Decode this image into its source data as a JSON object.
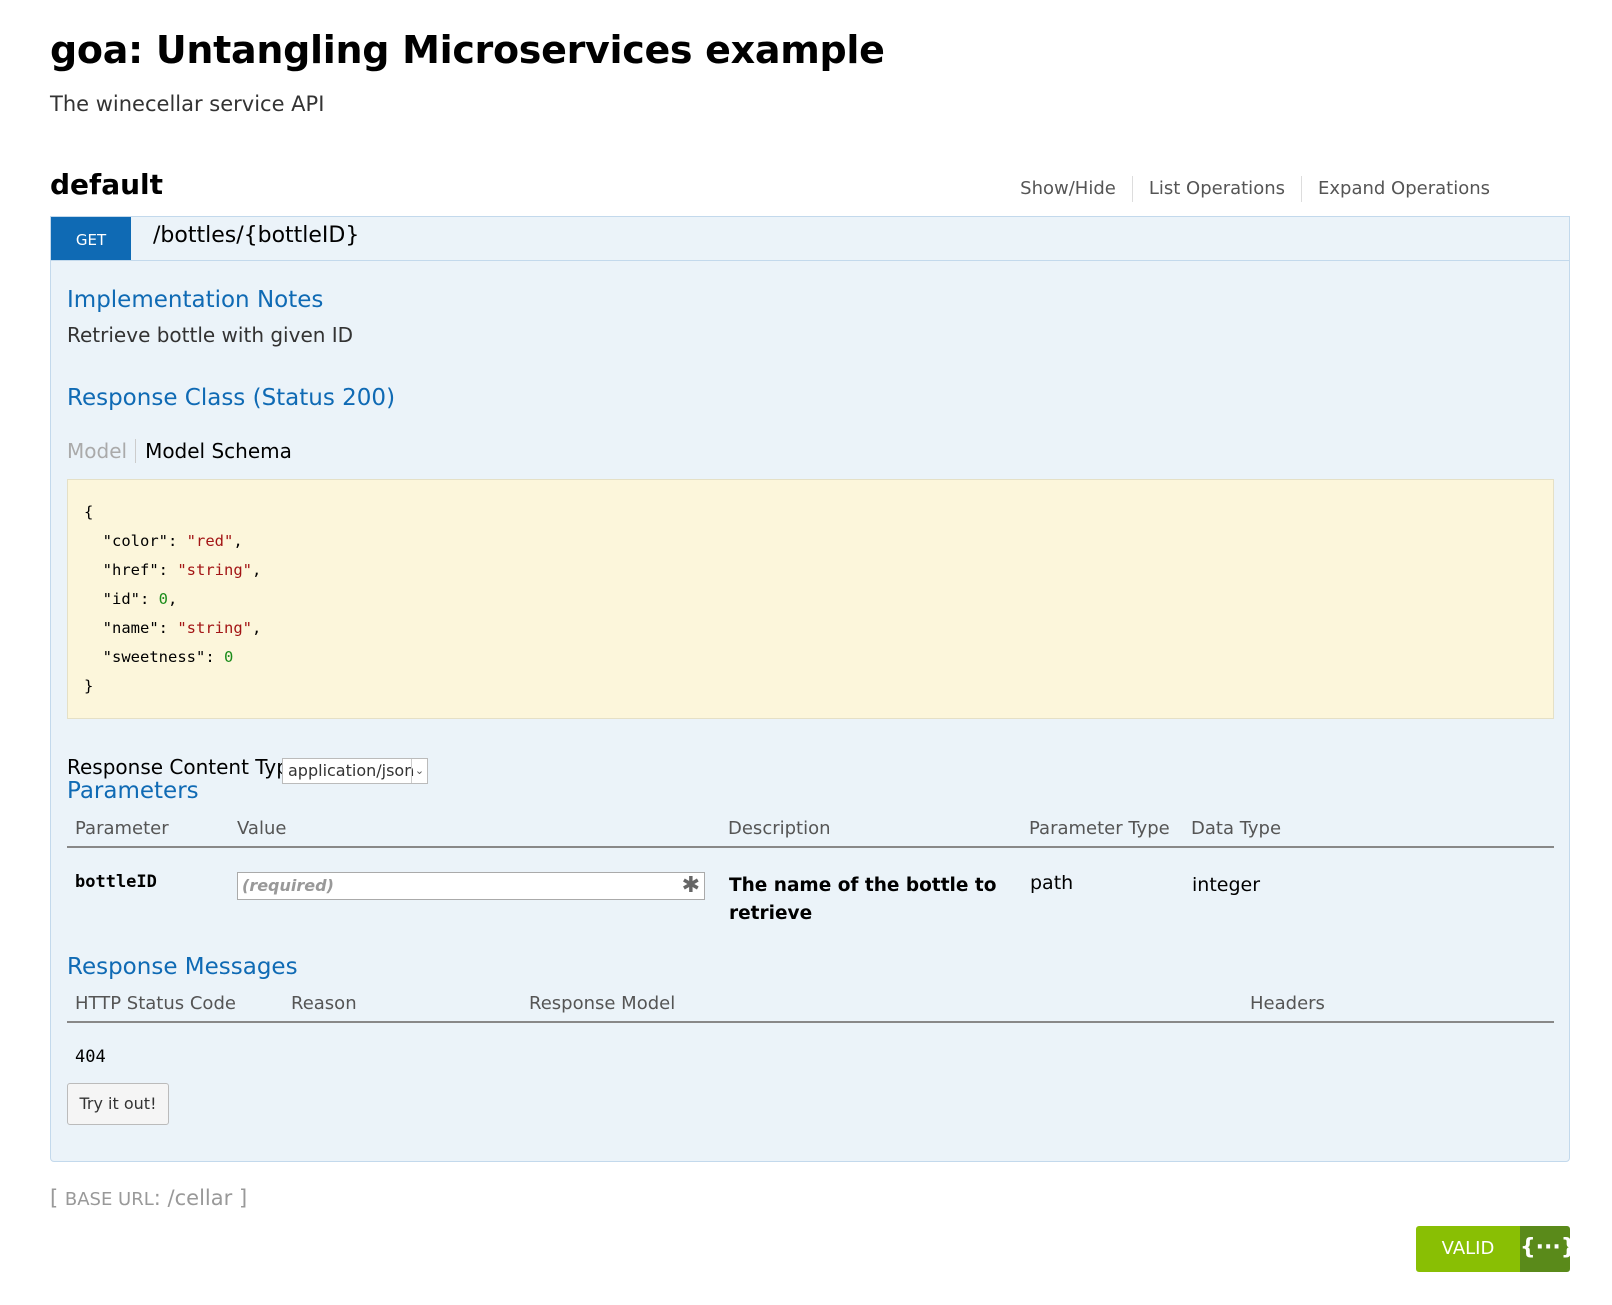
{
  "info": {
    "title": "goa: Untangling Microservices example",
    "description": "The winecellar service API"
  },
  "resource": {
    "name": "default",
    "actions": [
      "Show/Hide",
      "List Operations",
      "Expand Operations"
    ]
  },
  "operation": {
    "method": "GET",
    "path": "/bottles/{bottleID}",
    "implementation_notes_heading": "Implementation Notes",
    "implementation_notes": "Retrieve bottle with given ID",
    "response_class_heading": "Response Class (Status 200)",
    "model_tab": "Model",
    "model_schema_tab": "Model Schema",
    "schema": {
      "open": "{",
      "close": "}",
      "fields": [
        {
          "key": "\"color\"",
          "value": "\"red\"",
          "kind": "string",
          "sep": ","
        },
        {
          "key": "\"href\"",
          "value": "\"string\"",
          "kind": "string",
          "sep": ","
        },
        {
          "key": "\"id\"",
          "value": "0",
          "kind": "number",
          "sep": ","
        },
        {
          "key": "\"name\"",
          "value": "\"string\"",
          "kind": "string",
          "sep": ","
        },
        {
          "key": "\"sweetness\"",
          "value": "0",
          "kind": "number",
          "sep": ""
        }
      ]
    },
    "response_content_type_label": "Response Content Type",
    "response_content_type_value": "application/json",
    "parameters_heading": "Parameters",
    "parameters_columns": [
      "Parameter",
      "Value",
      "Description",
      "Parameter Type",
      "Data Type"
    ],
    "parameters": [
      {
        "name": "bottleID",
        "placeholder": "(required)",
        "description": "The name of the bottle to retrieve",
        "param_type": "path",
        "data_type": "integer"
      }
    ],
    "response_messages_heading": "Response Messages",
    "response_messages_columns": [
      "HTTP Status Code",
      "Reason",
      "Response Model",
      "Headers"
    ],
    "response_messages": [
      {
        "code": "404"
      }
    ],
    "try_button": "Try it out!"
  },
  "footer": {
    "base_url_label": "Base URL",
    "base_url_value": "/cellar",
    "validator_text": "VALID",
    "validator_icon": "{···}"
  },
  "colors": {
    "get_method": "#0f6ab4",
    "heading_blue": "#0f6ab4",
    "op_background": "#ebf3f9",
    "schema_background": "#fcf6db",
    "valid_green": "#89bf04"
  }
}
